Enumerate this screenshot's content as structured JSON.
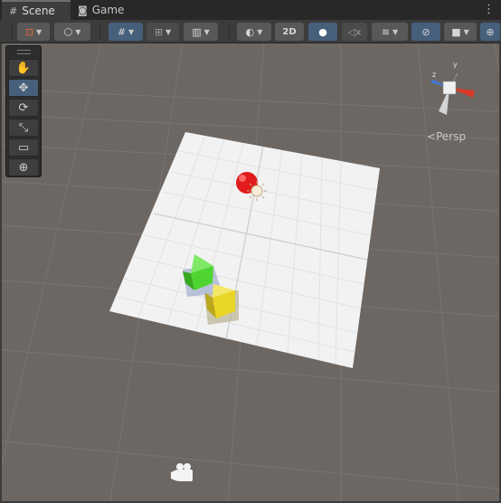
{
  "tabs": [
    {
      "label": "Scene",
      "icon": "grid-icon"
    },
    {
      "label": "Game",
      "icon": "gamepad-icon"
    }
  ],
  "menu_icon": "kebab-menu-icon",
  "toolbar": {
    "draw_mode_icon": "shading-mode-icon",
    "render_icon": "render-cube-icon",
    "grid_snap_icon": "grid-snap-icon",
    "increment_icon": "increment-snap-icon",
    "ruler_icon": "ruler-icon",
    "shading_icon": "sphere-shading-icon",
    "two_d_label": "2D",
    "lighting_icon": "lightbulb-icon",
    "audio_icon": "audio-mute-icon",
    "effects_icon": "effects-layers-icon",
    "visibility_icon": "hidden-eye-icon",
    "camera_icon": "camera-icon",
    "gizmos_icon": "gizmos-globe-icon"
  },
  "tool_palette": [
    {
      "name": "hand-tool",
      "icon": "hand-icon",
      "glyph": "✋"
    },
    {
      "name": "move-tool",
      "icon": "move-arrows-icon",
      "glyph": "✥"
    },
    {
      "name": "rotate-tool",
      "icon": "rotate-icon",
      "glyph": "⟳"
    },
    {
      "name": "scale-tool",
      "icon": "scale-icon",
      "glyph": "⤡"
    },
    {
      "name": "rect-tool",
      "icon": "rect-icon",
      "glyph": "▭"
    },
    {
      "name": "transform-tool",
      "icon": "transform-icon",
      "glyph": "⊕"
    }
  ],
  "orientation": {
    "label": "Persp",
    "axis_labels": {
      "y": "y",
      "z": "z"
    }
  },
  "scene_colors": {
    "background": "#6d6763",
    "grid_line": "#7a7471",
    "plane": "#f2f2f2",
    "sphere": "#e21c1c",
    "green_cube": "#4fd531",
    "yellow_cube": "#e9d526"
  }
}
